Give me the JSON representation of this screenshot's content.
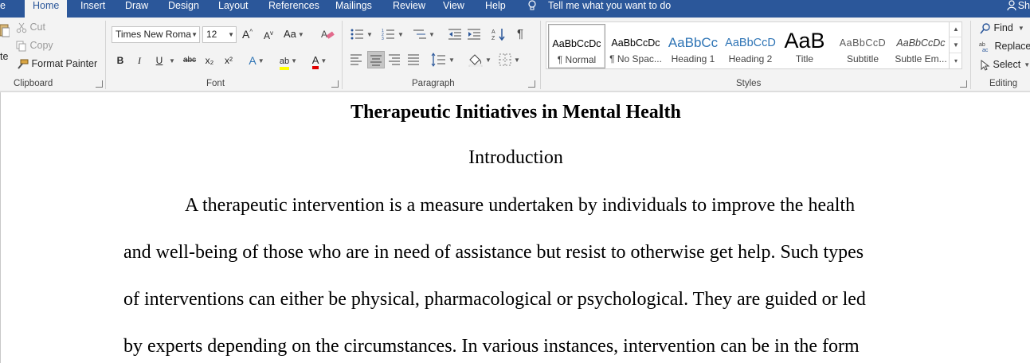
{
  "tabs": {
    "file_partial": "e",
    "home": "Home",
    "insert": "Insert",
    "draw": "Draw",
    "design": "Design",
    "layout": "Layout",
    "references": "References",
    "mailings": "Mailings",
    "review": "Review",
    "view": "View",
    "help": "Help",
    "tell_me": "Tell me what you want to do",
    "share_partial": "Sh"
  },
  "clipboard": {
    "paste_partial": "te",
    "cut": "Cut",
    "copy": "Copy",
    "format_painter": "Format Painter",
    "group_label": "Clipboard"
  },
  "font": {
    "font_name": "Times New Roma",
    "font_size": "12",
    "grow": "A",
    "shrink": "A",
    "case": "Aa",
    "bold": "B",
    "italic": "I",
    "underline": "U",
    "strikethrough": "abc",
    "subscript": "x₂",
    "superscript": "x²",
    "text_effects": "A",
    "highlight": "ab",
    "font_color": "A",
    "group_label": "Font",
    "highlight_color": "#ffff00",
    "font_color_swatch": "#e00000"
  },
  "paragraph": {
    "group_label": "Paragraph"
  },
  "styles": {
    "group_label": "Styles",
    "items": [
      {
        "preview": "AaBbCcDc",
        "name": "¶ Normal"
      },
      {
        "preview": "AaBbCcDc",
        "name": "¶ No Spac..."
      },
      {
        "preview": "AaBbCc",
        "name": "Heading 1"
      },
      {
        "preview": "AaBbCcD",
        "name": "Heading 2"
      },
      {
        "preview": "AaB",
        "name": "Title"
      },
      {
        "preview": "AaBbCcD",
        "name": "Subtitle"
      },
      {
        "preview": "AaBbCcDc",
        "name": "Subtle Em..."
      }
    ]
  },
  "editing": {
    "find": "Find",
    "replace": "Replace",
    "select": "Select",
    "group_label": "Editing"
  },
  "document": {
    "title": "Therapeutic Initiatives in Mental Health",
    "heading": "Introduction",
    "lines": [
      "A therapeutic intervention is a measure undertaken by individuals to improve the health",
      "and well-being of those who are in need of assistance but resist to otherwise get help. Such types",
      "of interventions can either be physical, pharmacological or psychological. They are guided or led",
      "by experts depending on the circumstances. In various instances, intervention can be in the form"
    ]
  },
  "colors": {
    "accent": "#2b579a",
    "heading_style": "#2e74b5"
  }
}
